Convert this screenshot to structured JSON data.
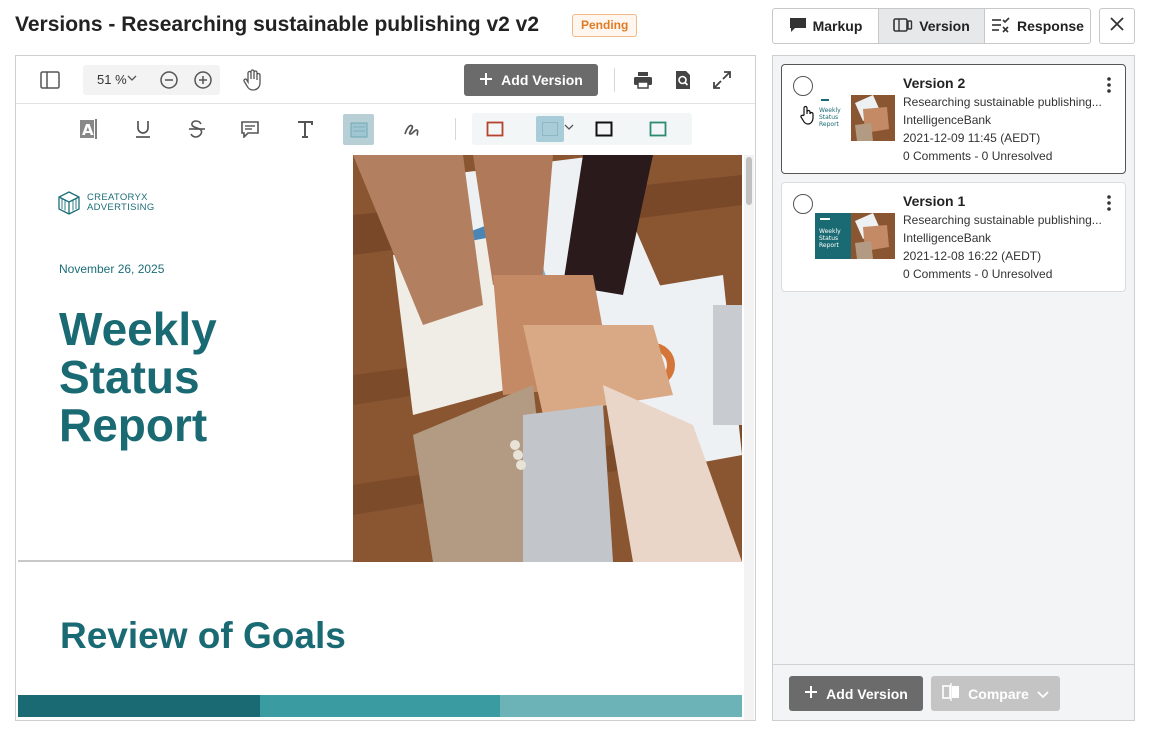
{
  "header": {
    "title": "Versions - Researching sustainable publishing v2 v2",
    "status": "Pending"
  },
  "tabs": [
    {
      "label": "Markup",
      "icon": "comment-icon"
    },
    {
      "label": "Version",
      "icon": "version-icon",
      "active": true
    },
    {
      "label": "Response",
      "icon": "response-checklist-icon"
    }
  ],
  "viewer": {
    "zoom": "51 %",
    "add_version_label": "Add Version"
  },
  "document": {
    "logo_line1": "CREATORYX",
    "logo_line2": "ADVERTISING",
    "date": "November 26, 2025",
    "title_lines": [
      "Weekly",
      "Status",
      "Report"
    ],
    "section_heading": "Review of Goals"
  },
  "versions": [
    {
      "title": "Version 2",
      "description": "Researching sustainable publishing...",
      "company": "IntelligenceBank",
      "timestamp": "2021-12-09 11:45 (AEDT)",
      "comments": "0 Comments - 0 Unresolved"
    },
    {
      "title": "Version 1",
      "description": "Researching sustainable publishing...",
      "company": "IntelligenceBank",
      "timestamp": "2021-12-08 16:22 (AEDT)",
      "comments": "0 Comments - 0 Unresolved"
    }
  ],
  "footer": {
    "add_version_label": "Add Version",
    "compare_label": "Compare"
  },
  "colors": {
    "teal": "#1a6a73",
    "pending": "#e07b25",
    "button_gray": "#6b6b6b"
  }
}
